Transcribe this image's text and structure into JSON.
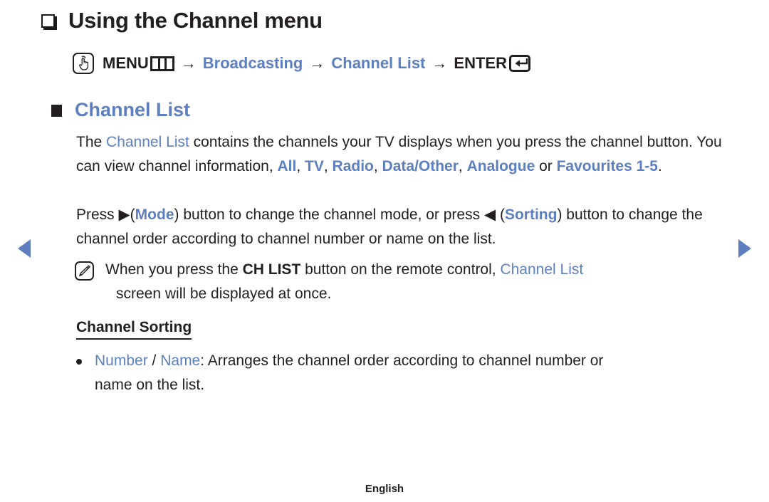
{
  "page": {
    "title": "Using the Channel menu",
    "title_bullet_icon": "open-square-bullet-icon",
    "footer_language": "English"
  },
  "nav": {
    "prev_icon": "left-triangle-arrow-icon",
    "next_icon": "right-triangle-arrow-icon",
    "arrow_color": "#5d7fc0"
  },
  "menu_path": {
    "hand_icon": "hand-press-icon",
    "menu_label": "MENU",
    "menu_icon": "menu-bars-icon",
    "arrow1": "→",
    "step1": "Broadcasting",
    "arrow2": "→",
    "step2": "Channel List",
    "arrow3": "→",
    "enter_label": "ENTER",
    "enter_icon": "enter-return-icon"
  },
  "section": {
    "bullet_icon": "filled-square-bullet-icon",
    "heading": "Channel List",
    "heading_color": "#5d7fc0"
  },
  "paragraph1": {
    "t1": "The ",
    "term1": "Channel List",
    "t2": " contains the channels your TV displays when you press the channel button. You can view channel information, ",
    "term2": "All",
    "t3": ", ",
    "term3": "TV",
    "t4": ", ",
    "term4": "Radio",
    "t5": ", ",
    "term5": "Data/Other",
    "t6": ", ",
    "term6": "Analogue",
    "t7": " or ",
    "term7": "Favourites 1-5",
    "t8": "."
  },
  "paragraph2": {
    "t1": "Press ",
    "arrow_right": "▶",
    "t2": "(",
    "term1": "Mode",
    "t3": ") button to change the channel mode, or press ",
    "arrow_left": "◀",
    "t4": " (",
    "term2": "Sorting",
    "t5": ") button to change the channel order according to channel number or name on the list."
  },
  "note": {
    "icon": "note-pencil-icon",
    "t1": "When you press the ",
    "term1": "CH LIST",
    "t2": " button on the remote control, ",
    "term2": "Channel List",
    "t3_line2": "screen will be displayed at once."
  },
  "sub_section": {
    "heading": "Channel Sorting"
  },
  "bullet_item": {
    "bullet_icon": "round-dot-bullet-icon",
    "term1": "Number",
    "t1": " / ",
    "term2": "Name",
    "t2": ": Arranges the channel order according to channel number or",
    "t3_line2": "name on the list."
  }
}
